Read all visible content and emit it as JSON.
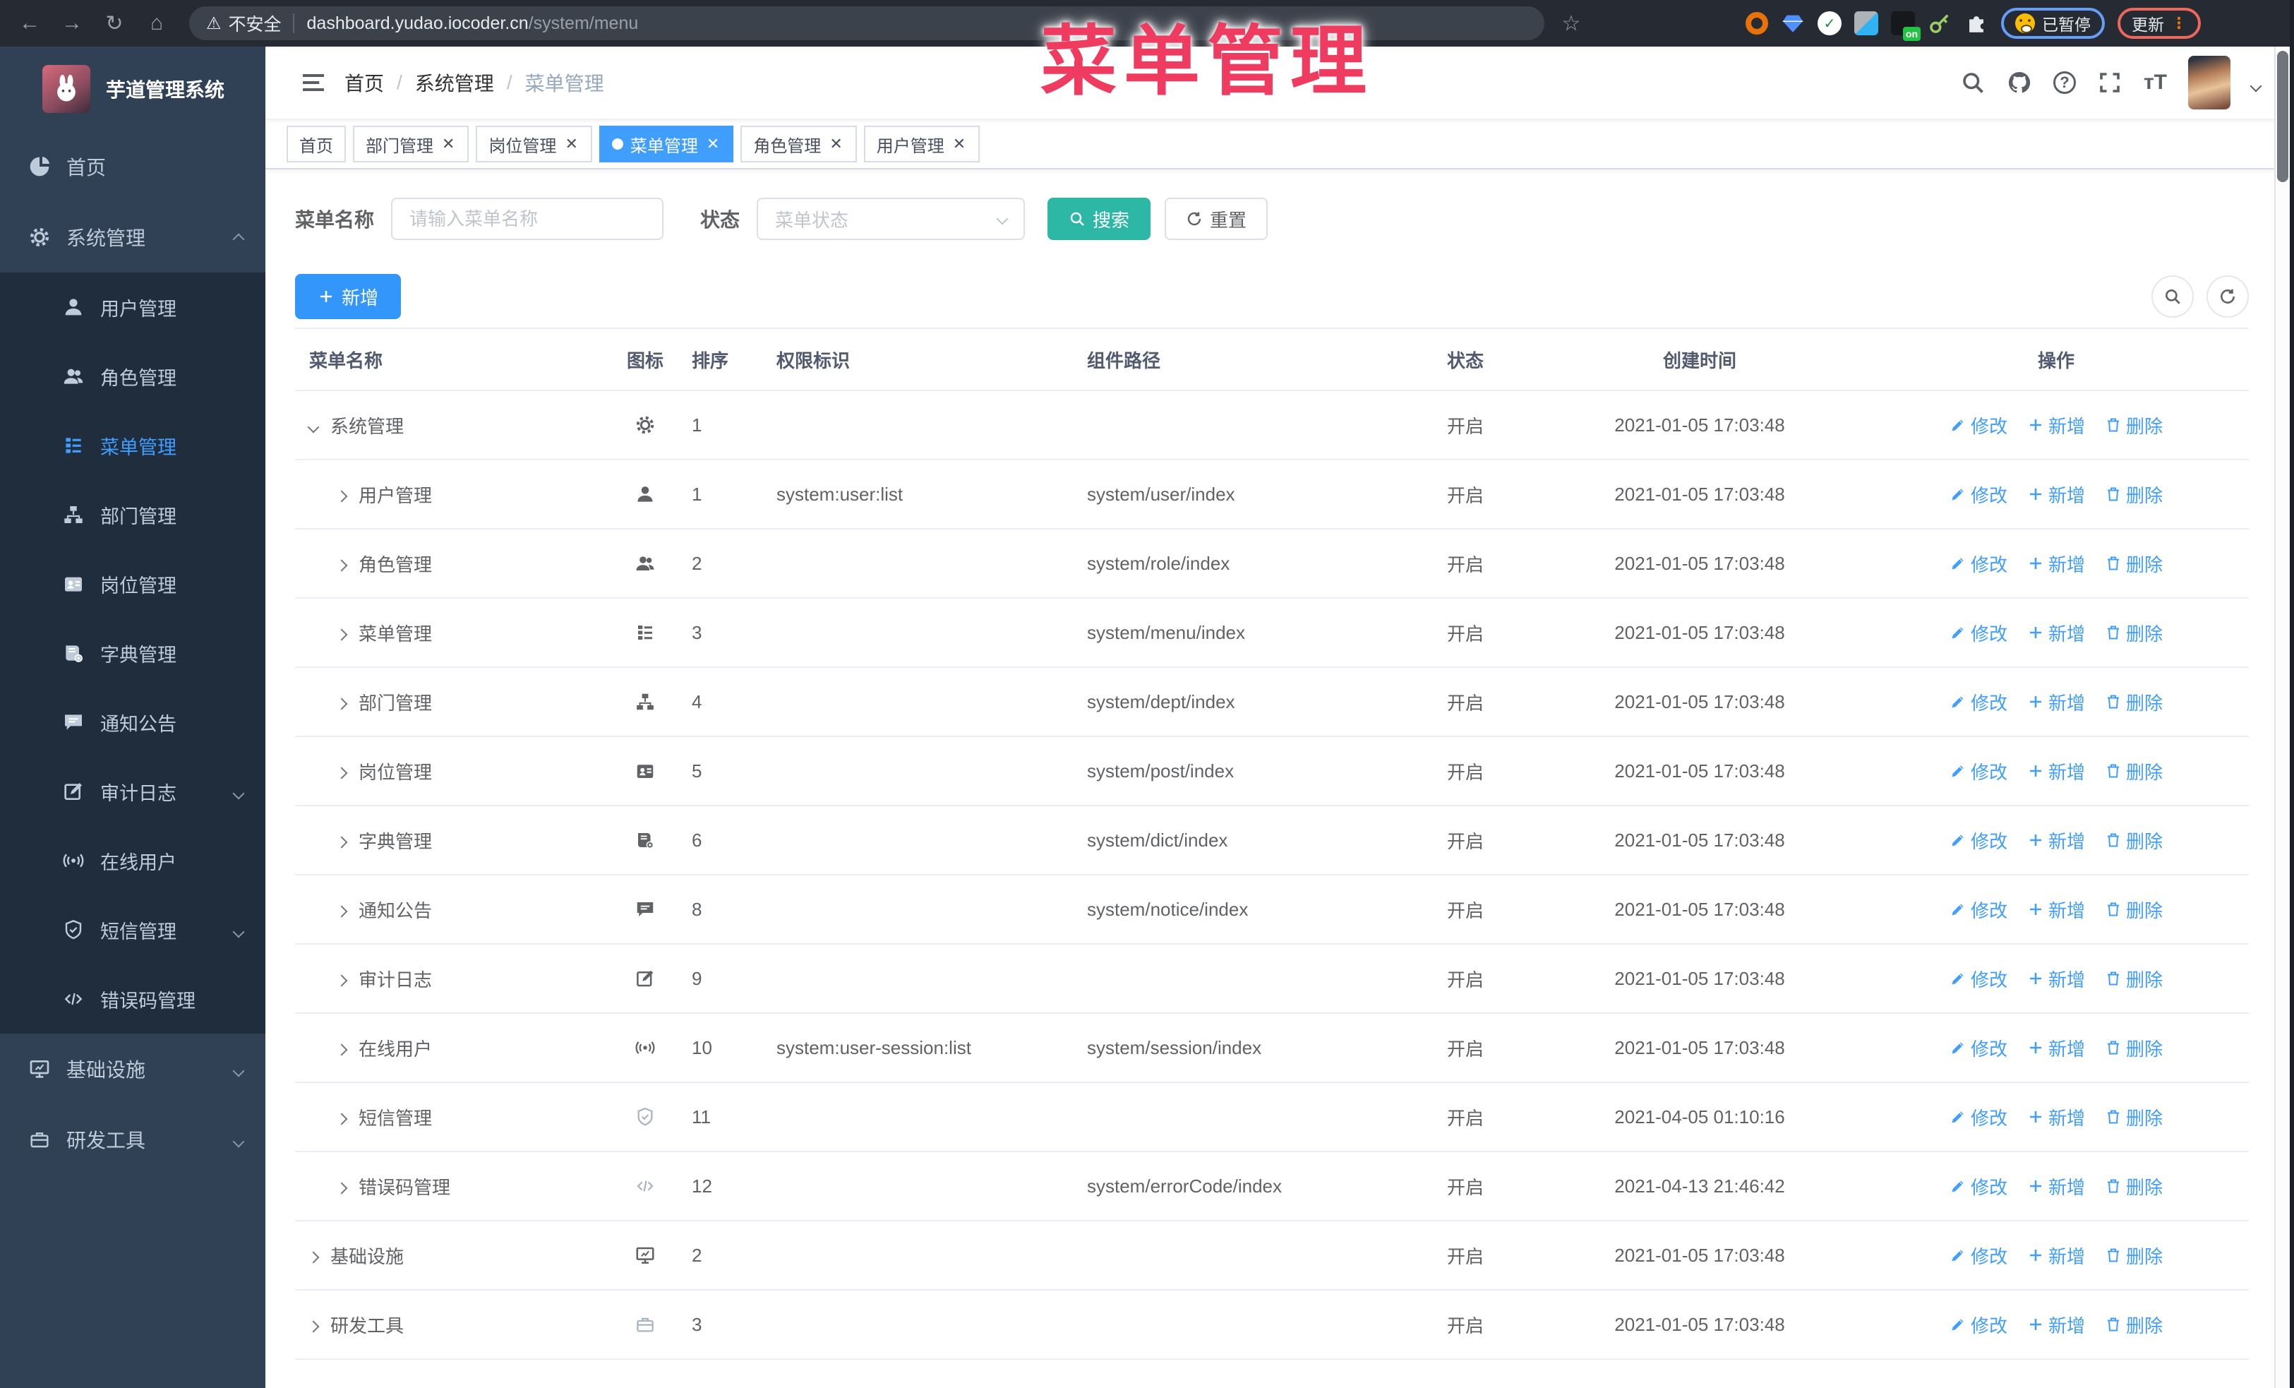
{
  "browser": {
    "security_label": "不安全",
    "url_host": "dashboard.yudao.iocoder.cn",
    "url_path": "/system/menu",
    "on_badge": "on",
    "paused_label": "已暂停",
    "update_label": "更新"
  },
  "overlay": {
    "title": "菜单管理"
  },
  "sidebar": {
    "logo_title": "芋道管理系统",
    "items": [
      {
        "label": "首页",
        "icon": "dashboard",
        "level": 0
      },
      {
        "label": "系统管理",
        "icon": "gear",
        "level": 0,
        "caret": "u"
      },
      {
        "label": "用户管理",
        "icon": "user",
        "level": 1
      },
      {
        "label": "角色管理",
        "icon": "users",
        "level": 1
      },
      {
        "label": "菜单管理",
        "icon": "menu",
        "level": 1,
        "active": true
      },
      {
        "label": "部门管理",
        "icon": "tree",
        "level": 1
      },
      {
        "label": "岗位管理",
        "icon": "badge",
        "level": 1
      },
      {
        "label": "字典管理",
        "icon": "book",
        "level": 1
      },
      {
        "label": "通知公告",
        "icon": "message",
        "level": 1
      },
      {
        "label": "审计日志",
        "icon": "edit",
        "level": 1,
        "caret": "d"
      },
      {
        "label": "在线用户",
        "icon": "online",
        "level": 1
      },
      {
        "label": "短信管理",
        "icon": "shield",
        "level": 1,
        "caret": "d"
      },
      {
        "label": "错误码管理",
        "icon": "code",
        "level": 1
      },
      {
        "label": "基础设施",
        "icon": "monitor",
        "level": 0,
        "caret": "d"
      },
      {
        "label": "研发工具",
        "icon": "tool",
        "level": 0,
        "caret": "d"
      }
    ]
  },
  "breadcrumb": {
    "items": [
      "首页",
      "系统管理",
      "菜单管理"
    ]
  },
  "tabs": [
    {
      "label": "首页",
      "closable": false,
      "active": false
    },
    {
      "label": "部门管理",
      "closable": true,
      "active": false
    },
    {
      "label": "岗位管理",
      "closable": true,
      "active": false
    },
    {
      "label": "菜单管理",
      "closable": true,
      "active": true
    },
    {
      "label": "角色管理",
      "closable": true,
      "active": false
    },
    {
      "label": "用户管理",
      "closable": true,
      "active": false
    }
  ],
  "filters": {
    "name_label": "菜单名称",
    "name_placeholder": "请输入菜单名称",
    "status_label": "状态",
    "status_placeholder": "菜单状态",
    "search_label": "搜索",
    "reset_label": "重置"
  },
  "toolbar": {
    "add_label": "新增"
  },
  "table": {
    "columns": [
      "菜单名称",
      "图标",
      "排序",
      "权限标识",
      "组件路径",
      "状态",
      "创建时间",
      "操作"
    ],
    "actions": {
      "edit": "修改",
      "add": "新增",
      "delete": "删除"
    },
    "rows": [
      {
        "name": "系统管理",
        "level": 0,
        "expanded": true,
        "icon": "gear",
        "sort": "1",
        "perms": "",
        "path": "",
        "status": "开启",
        "time": "2021-01-05 17:03:48"
      },
      {
        "name": "用户管理",
        "level": 1,
        "expanded": false,
        "icon": "user",
        "sort": "1",
        "perms": "system:user:list",
        "path": "system/user/index",
        "status": "开启",
        "time": "2021-01-05 17:03:48"
      },
      {
        "name": "角色管理",
        "level": 1,
        "expanded": false,
        "icon": "users",
        "sort": "2",
        "perms": "",
        "path": "system/role/index",
        "status": "开启",
        "time": "2021-01-05 17:03:48"
      },
      {
        "name": "菜单管理",
        "level": 1,
        "expanded": false,
        "icon": "menu",
        "sort": "3",
        "perms": "",
        "path": "system/menu/index",
        "status": "开启",
        "time": "2021-01-05 17:03:48"
      },
      {
        "name": "部门管理",
        "level": 1,
        "expanded": false,
        "icon": "tree",
        "sort": "4",
        "perms": "",
        "path": "system/dept/index",
        "status": "开启",
        "time": "2021-01-05 17:03:48"
      },
      {
        "name": "岗位管理",
        "level": 1,
        "expanded": false,
        "icon": "badge",
        "sort": "5",
        "perms": "",
        "path": "system/post/index",
        "status": "开启",
        "time": "2021-01-05 17:03:48"
      },
      {
        "name": "字典管理",
        "level": 1,
        "expanded": false,
        "icon": "book",
        "sort": "6",
        "perms": "",
        "path": "system/dict/index",
        "status": "开启",
        "time": "2021-01-05 17:03:48"
      },
      {
        "name": "通知公告",
        "level": 1,
        "expanded": false,
        "icon": "message",
        "sort": "8",
        "perms": "",
        "path": "system/notice/index",
        "status": "开启",
        "time": "2021-01-05 17:03:48"
      },
      {
        "name": "审计日志",
        "level": 1,
        "expanded": false,
        "icon": "edit",
        "sort": "9",
        "perms": "",
        "path": "",
        "status": "开启",
        "time": "2021-01-05 17:03:48"
      },
      {
        "name": "在线用户",
        "level": 1,
        "expanded": false,
        "icon": "online",
        "sort": "10",
        "perms": "system:user-session:list",
        "path": "system/session/index",
        "status": "开启",
        "time": "2021-01-05 17:03:48"
      },
      {
        "name": "短信管理",
        "level": 1,
        "expanded": false,
        "icon": "shield",
        "light": true,
        "sort": "11",
        "perms": "",
        "path": "",
        "status": "开启",
        "time": "2021-04-05 01:10:16"
      },
      {
        "name": "错误码管理",
        "level": 1,
        "expanded": false,
        "icon": "code",
        "light": true,
        "sort": "12",
        "perms": "",
        "path": "system/errorCode/index",
        "status": "开启",
        "time": "2021-04-13 21:46:42"
      },
      {
        "name": "基础设施",
        "level": 0,
        "expanded": false,
        "icon": "monitor",
        "sort": "2",
        "perms": "",
        "path": "",
        "status": "开启",
        "time": "2021-01-05 17:03:48"
      },
      {
        "name": "研发工具",
        "level": 0,
        "expanded": false,
        "icon": "tool",
        "light": true,
        "sort": "3",
        "perms": "",
        "path": "",
        "status": "开启",
        "time": "2021-01-05 17:03:48"
      }
    ]
  }
}
